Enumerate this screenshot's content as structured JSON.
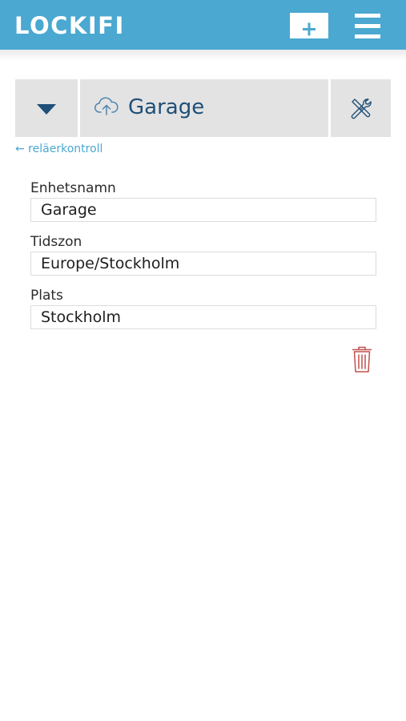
{
  "header": {
    "logo": "LOCKIFI",
    "add_icon": "plus-icon",
    "menu_icon": "hamburger-menu-icon",
    "color": "#4aa8d1"
  },
  "device": {
    "name": "Garage",
    "status_icon": "cloud-upload-icon",
    "dropdown_icon": "caret-down-icon",
    "settings_icon": "tools-icon"
  },
  "back_link": "← reläerkontroll",
  "form": {
    "unit_name_label": "Enhetsnamn",
    "unit_name_value": "Garage",
    "timezone_label": "Tidszon",
    "timezone_value": "Europe/Stockholm",
    "location_label": "Plats",
    "location_value": "Stockholm"
  },
  "delete_icon": "trash-icon",
  "colors": {
    "accent": "#4aa8d1",
    "title": "#1f4f78",
    "delete": "#c0504d"
  }
}
